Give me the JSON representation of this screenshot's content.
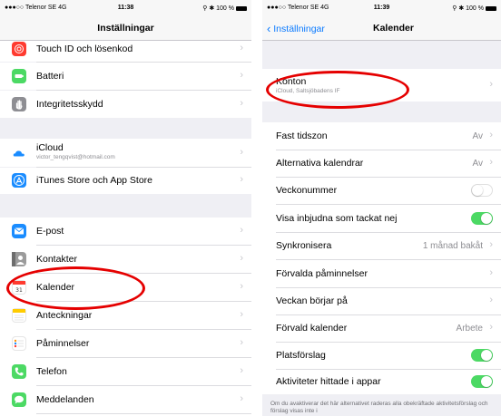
{
  "left": {
    "status": {
      "carrier": "●●●○○ Telenor SE  4G",
      "time": "11:38",
      "battery": "⚲ ✱ 100 %"
    },
    "nav": {
      "title": "Inställningar"
    },
    "rows": [
      {
        "label": "Touch ID och lösenkod",
        "icon": "fingerprint-icon",
        "color": "#ff3b30"
      },
      {
        "label": "Batteri",
        "icon": "battery-icon",
        "color": "#4cd964"
      },
      {
        "label": "Integritetsskydd",
        "icon": "hand-icon",
        "color": "#8e8e93"
      },
      {
        "label": "iCloud",
        "sub": "victor_tengqvist@hotmail.com",
        "icon": "cloud-icon",
        "color": "#ffffff"
      },
      {
        "label": "iTunes Store och App Store",
        "icon": "app-store-icon",
        "color": "#1a8cff"
      },
      {
        "label": "E-post",
        "icon": "mail-icon",
        "color": "#1a8cff"
      },
      {
        "label": "Kontakter",
        "icon": "contacts-icon",
        "color": "#9b9b9b"
      },
      {
        "label": "Kalender",
        "icon": "calendar-icon",
        "color": "#ffffff"
      },
      {
        "label": "Anteckningar",
        "icon": "notes-icon",
        "color": "#ffcc00"
      },
      {
        "label": "Påminnelser",
        "icon": "reminders-icon",
        "color": "#ffffff"
      },
      {
        "label": "Telefon",
        "icon": "phone-icon",
        "color": "#4cd964"
      },
      {
        "label": "Meddelanden",
        "icon": "messages-icon",
        "color": "#4cd964"
      }
    ]
  },
  "right": {
    "status": {
      "carrier": "●●●○○ Telenor SE  4G",
      "time": "11:39",
      "battery": "⚲ ✱ 100 %"
    },
    "nav": {
      "back": "Inställningar",
      "title": "Kalender"
    },
    "account": {
      "label": "Konton",
      "sub": "iCloud, Saltsjöbadens IF"
    },
    "rows": [
      {
        "label": "Fast tidszon",
        "value": "Av"
      },
      {
        "label": "Alternativa kalendrar",
        "value": "Av"
      },
      {
        "label": "Veckonummer",
        "toggle": "off"
      },
      {
        "label": "Visa inbjudna som tackat nej",
        "toggle": "on"
      },
      {
        "label": "Synkronisera",
        "value": "1 månad bakåt"
      },
      {
        "label": "Förvalda påminnelser"
      },
      {
        "label": "Veckan börjar på"
      },
      {
        "label": "Förvald kalender",
        "value": "Arbete"
      },
      {
        "label": "Platsförslag",
        "toggle": "on"
      },
      {
        "label": "Aktiviteter hittade i appar",
        "toggle": "on"
      }
    ],
    "footer": "Om du avaktiverar det här alternativet raderas alla obekräftade aktivitetsförslag och förslag visas inte i"
  },
  "colors": {
    "accent": "#0a7aff",
    "toggle_on": "#4cd964",
    "annotation": "#e50000"
  }
}
